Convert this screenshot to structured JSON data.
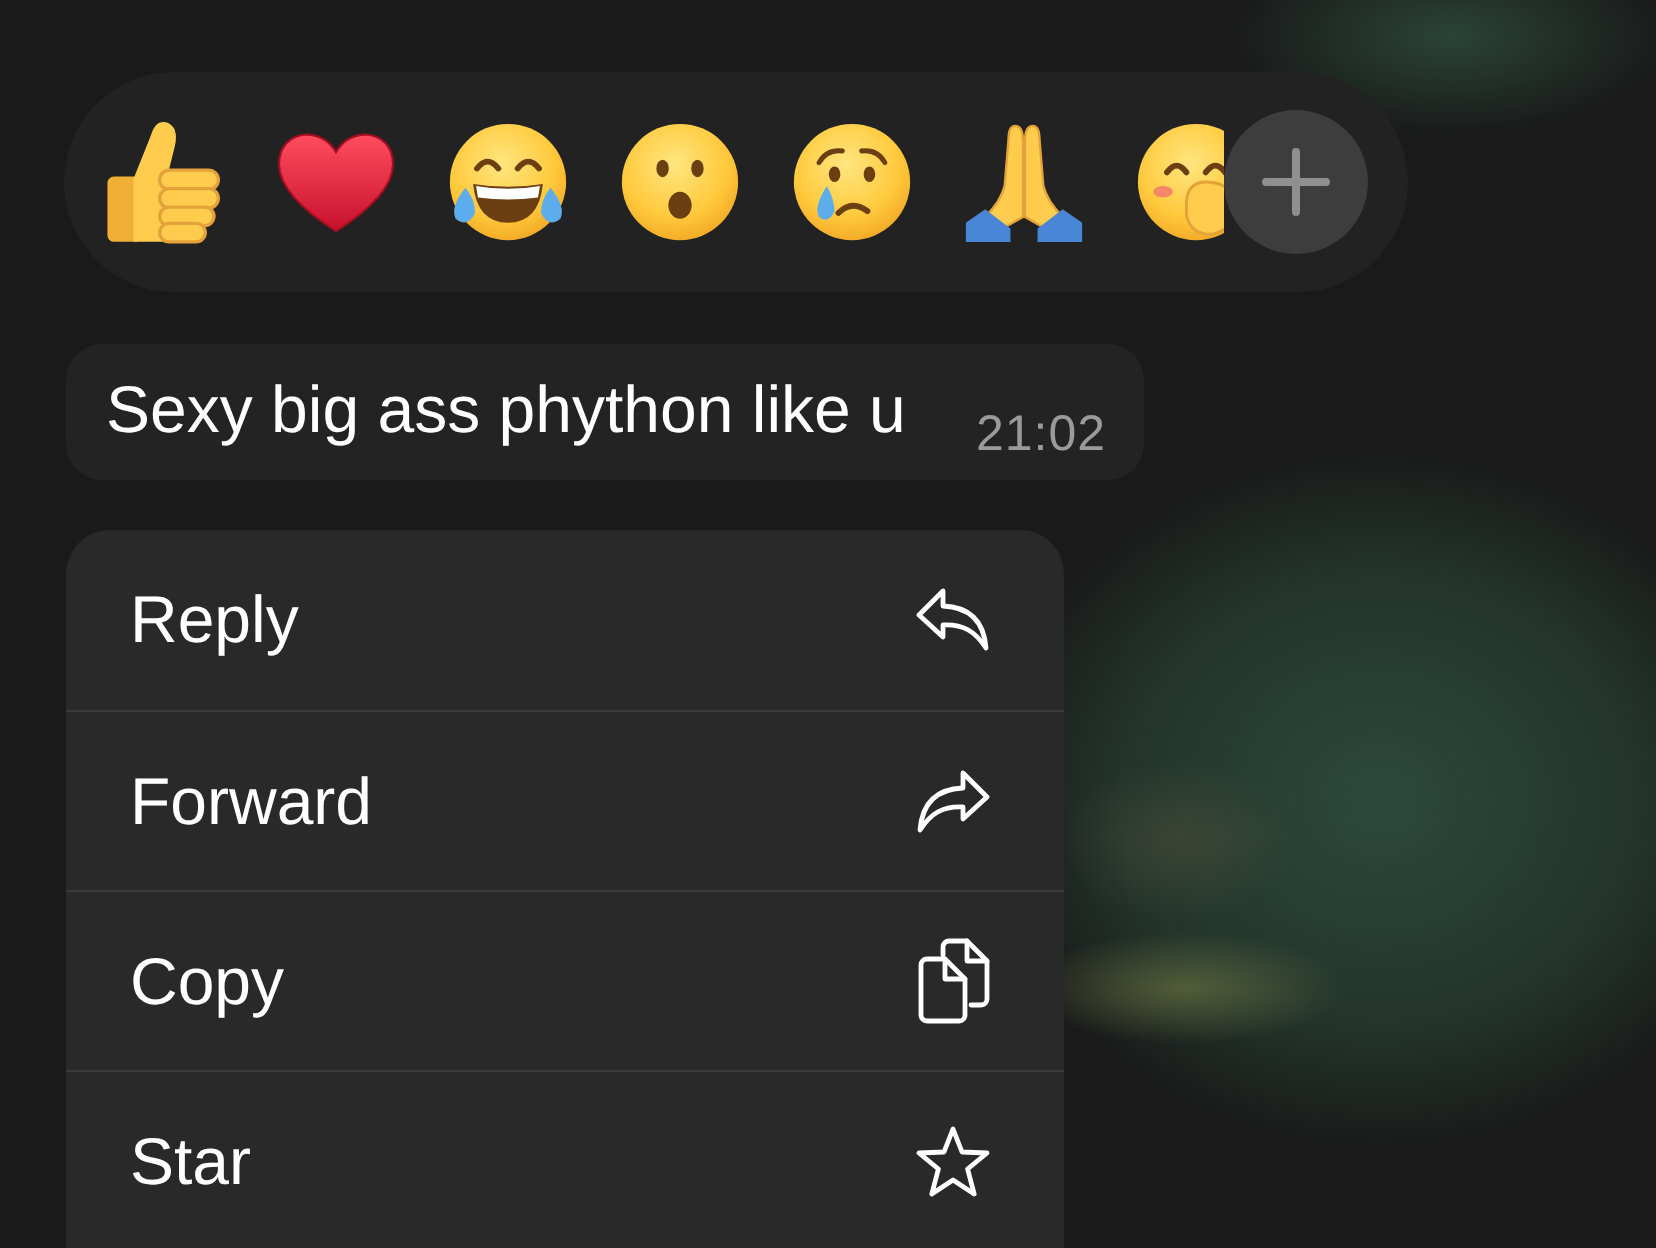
{
  "reaction_bar": {
    "reactions": [
      {
        "kind": "thumbs_up"
      },
      {
        "kind": "heart"
      },
      {
        "kind": "tears_of_joy"
      },
      {
        "kind": "surprised"
      },
      {
        "kind": "crying"
      },
      {
        "kind": "folded_hands"
      },
      {
        "kind": "hand_over_mouth"
      }
    ]
  },
  "message": {
    "text": "Sexy big ass phython like u",
    "time": "21:02"
  },
  "menu": {
    "items": [
      {
        "label": "Reply",
        "kind": "reply"
      },
      {
        "label": "Forward",
        "kind": "forward"
      },
      {
        "label": "Copy",
        "kind": "copy"
      },
      {
        "label": "Star",
        "kind": "star"
      }
    ]
  }
}
